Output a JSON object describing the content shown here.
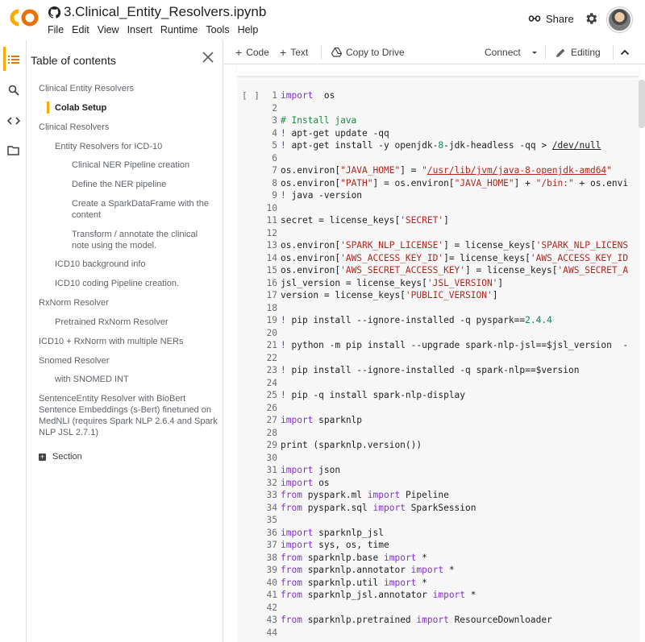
{
  "header": {
    "notebook_title": "3.Clinical_Entity_Resolvers.ipynb",
    "menu": [
      "File",
      "Edit",
      "View",
      "Insert",
      "Runtime",
      "Tools",
      "Help"
    ],
    "share_label": "Share",
    "logo_text": "CO"
  },
  "toc": {
    "title": "Table of contents",
    "items": [
      {
        "label": "Clinical Entity Resolvers",
        "level": 1
      },
      {
        "label": "Colab Setup",
        "level": 2,
        "active": true
      },
      {
        "label": "Clinical Resolvers",
        "level": 1
      },
      {
        "label": "Entity Resolvers for ICD-10",
        "level": 2
      },
      {
        "label": "Clinical NER Pipeline creation",
        "level": 3
      },
      {
        "label": "Define the NER pipeline",
        "level": 3
      },
      {
        "label": "Create a SparkDataFrame with the content",
        "level": 3
      },
      {
        "label": "Transform / annotate the clinical note using the model.",
        "level": 3
      },
      {
        "label": "ICD10 background info",
        "level": 2
      },
      {
        "label": "ICD10 coding Pipeline creation.",
        "level": 2
      },
      {
        "label": "RxNorm Resolver",
        "level": 1
      },
      {
        "label": "Pretrained RxNorm Resolver",
        "level": 2
      },
      {
        "label": "ICD10 + RxNorm with multiple NERs",
        "level": 1
      },
      {
        "label": "Snomed Resolver",
        "level": 1
      },
      {
        "label": "with SNOMED INT",
        "level": 2
      },
      {
        "label": "SentenceEntity Resolver with BioBert Sentence Embeddings (s-Bert) finetuned on MedNLI (requires Spark NLP 2.6.4 and Spark NLP JSL 2.7.1)",
        "level": 1
      }
    ],
    "section_label": "Section"
  },
  "toolbar": {
    "code_label": "Code",
    "text_label": "Text",
    "copy_label": "Copy to Drive",
    "connect_label": "Connect",
    "editing_label": "Editing"
  },
  "cell": {
    "run_label": "[ ]",
    "lines": [
      {
        "n": "1",
        "t": [
          [
            "kw",
            "import"
          ],
          [
            "",
            "  os"
          ]
        ]
      },
      {
        "n": "2",
        "t": []
      },
      {
        "n": "3",
        "t": [
          [
            "cm",
            "# Install java"
          ]
        ]
      },
      {
        "n": "4",
        "t": [
          [
            "bang",
            "!"
          ],
          [
            "",
            " apt-get update -qq"
          ]
        ]
      },
      {
        "n": "5",
        "t": [
          [
            "bang",
            "!"
          ],
          [
            "",
            " apt-get install -y openjdk-"
          ],
          [
            "nm",
            "8"
          ],
          [
            "",
            "-jdk-headless -qq > "
          ],
          [
            "ul",
            "/dev/null"
          ]
        ]
      },
      {
        "n": "6",
        "t": []
      },
      {
        "n": "7",
        "t": [
          [
            "",
            "os.environ["
          ],
          [
            "st",
            "\"JAVA_HOME\""
          ],
          [
            "",
            "] = "
          ],
          [
            "st",
            "\""
          ],
          [
            "st ul",
            "/usr/lib/jvm/java-8-openjdk-amd64"
          ],
          [
            "st",
            "\""
          ]
        ]
      },
      {
        "n": "8",
        "t": [
          [
            "",
            "os.environ["
          ],
          [
            "st",
            "\"PATH\""
          ],
          [
            "",
            "] = os.environ["
          ],
          [
            "st",
            "\"JAVA_HOME\""
          ],
          [
            "",
            "] + "
          ],
          [
            "st",
            "\"/bin:\""
          ],
          [
            "",
            " + os.envi"
          ]
        ]
      },
      {
        "n": "9",
        "t": [
          [
            "bang",
            "!"
          ],
          [
            "",
            " java -version"
          ]
        ]
      },
      {
        "n": "10",
        "t": []
      },
      {
        "n": "11",
        "t": [
          [
            "",
            "secret = license_keys["
          ],
          [
            "st",
            "'SECRET'"
          ],
          [
            "",
            "]"
          ]
        ]
      },
      {
        "n": "12",
        "t": []
      },
      {
        "n": "13",
        "t": [
          [
            "",
            "os.environ["
          ],
          [
            "st",
            "'SPARK_NLP_LICENSE'"
          ],
          [
            "",
            "] = license_keys["
          ],
          [
            "st",
            "'SPARK_NLP_LICENS"
          ]
        ]
      },
      {
        "n": "14",
        "t": [
          [
            "",
            "os.environ["
          ],
          [
            "st",
            "'AWS_ACCESS_KEY_ID'"
          ],
          [
            "",
            "]= license_keys["
          ],
          [
            "st",
            "'AWS_ACCESS_KEY_ID"
          ]
        ]
      },
      {
        "n": "15",
        "t": [
          [
            "",
            "os.environ["
          ],
          [
            "st",
            "'AWS_SECRET_ACCESS_KEY'"
          ],
          [
            "",
            "] = license_keys["
          ],
          [
            "st",
            "'AWS_SECRET_A"
          ]
        ]
      },
      {
        "n": "16",
        "t": [
          [
            "",
            "jsl_version = license_keys["
          ],
          [
            "st",
            "'JSL_VERSION'"
          ],
          [
            "",
            "]"
          ]
        ]
      },
      {
        "n": "17",
        "t": [
          [
            "",
            "version = license_keys["
          ],
          [
            "st",
            "'PUBLIC_VERSION'"
          ],
          [
            "",
            "]"
          ]
        ]
      },
      {
        "n": "18",
        "t": []
      },
      {
        "n": "19",
        "t": [
          [
            "bang",
            "!"
          ],
          [
            "",
            " pip install --ignore-installed -q pyspark=="
          ],
          [
            "nm",
            "2.4.4"
          ]
        ]
      },
      {
        "n": "20",
        "t": []
      },
      {
        "n": "21",
        "t": [
          [
            "bang",
            "!"
          ],
          [
            "",
            " python -m pip install --upgrade spark-nlp-jsl==$jsl_version  -"
          ]
        ]
      },
      {
        "n": "22",
        "t": []
      },
      {
        "n": "23",
        "t": [
          [
            "bang",
            "!"
          ],
          [
            "",
            " pip install --ignore-installed -q spark-nlp==$version"
          ]
        ]
      },
      {
        "n": "24",
        "t": []
      },
      {
        "n": "25",
        "t": [
          [
            "bang",
            "!"
          ],
          [
            "",
            " pip -q install spark-nlp-display"
          ]
        ]
      },
      {
        "n": "26",
        "t": []
      },
      {
        "n": "27",
        "t": [
          [
            "kw",
            "import"
          ],
          [
            "",
            " sparknlp"
          ]
        ]
      },
      {
        "n": "28",
        "t": []
      },
      {
        "n": "29",
        "t": [
          [
            "",
            "print (sparknlp.version())"
          ]
        ]
      },
      {
        "n": "30",
        "t": []
      },
      {
        "n": "31",
        "t": [
          [
            "kw",
            "import"
          ],
          [
            "",
            " json"
          ]
        ]
      },
      {
        "n": "32",
        "t": [
          [
            "kw",
            "import"
          ],
          [
            "",
            " os"
          ]
        ]
      },
      {
        "n": "33",
        "t": [
          [
            "kw",
            "from"
          ],
          [
            "",
            " pyspark.ml "
          ],
          [
            "kw",
            "import"
          ],
          [
            "",
            " Pipeline"
          ]
        ]
      },
      {
        "n": "34",
        "t": [
          [
            "kw",
            "from"
          ],
          [
            "",
            " pyspark.sql "
          ],
          [
            "kw",
            "import"
          ],
          [
            "",
            " SparkSession"
          ]
        ]
      },
      {
        "n": "35",
        "t": []
      },
      {
        "n": "36",
        "t": [
          [
            "kw",
            "import"
          ],
          [
            "",
            " sparknlp_jsl"
          ]
        ]
      },
      {
        "n": "37",
        "t": [
          [
            "kw",
            "import"
          ],
          [
            "",
            " sys, os, time"
          ]
        ]
      },
      {
        "n": "38",
        "t": [
          [
            "kw",
            "from"
          ],
          [
            "",
            " sparknlp.base "
          ],
          [
            "kw",
            "import"
          ],
          [
            "",
            " *"
          ]
        ]
      },
      {
        "n": "39",
        "t": [
          [
            "kw",
            "from"
          ],
          [
            "",
            " sparknlp.annotator "
          ],
          [
            "kw",
            "import"
          ],
          [
            "",
            " *"
          ]
        ]
      },
      {
        "n": "40",
        "t": [
          [
            "kw",
            "from"
          ],
          [
            "",
            " sparknlp.util "
          ],
          [
            "kw",
            "import"
          ],
          [
            "",
            " *"
          ]
        ]
      },
      {
        "n": "41",
        "t": [
          [
            "kw",
            "from"
          ],
          [
            "",
            " sparknlp_jsl.annotator "
          ],
          [
            "kw",
            "import"
          ],
          [
            "",
            " *"
          ]
        ]
      },
      {
        "n": "42",
        "t": []
      },
      {
        "n": "43",
        "t": [
          [
            "kw",
            "from"
          ],
          [
            "",
            " sparknlp.pretrained "
          ],
          [
            "kw",
            "import"
          ],
          [
            "",
            " ResourceDownloader"
          ]
        ]
      },
      {
        "n": "44",
        "t": []
      }
    ]
  },
  "colors": {
    "accent": "#f9ab00",
    "logo_orange": "#f9ab00",
    "keyword": "#8430ce",
    "comment": "#1b8a3f",
    "string": "#b3261e"
  },
  "icons": {
    "rail": [
      "toc-icon",
      "search-icon",
      "code-snippets-icon",
      "folder-icon"
    ],
    "header": [
      "github-icon",
      "share-icon",
      "gear-icon",
      "avatar"
    ],
    "toolbar": [
      "drive-icon",
      "chevron-down-icon",
      "pencil-icon",
      "chevron-up-icon"
    ]
  }
}
